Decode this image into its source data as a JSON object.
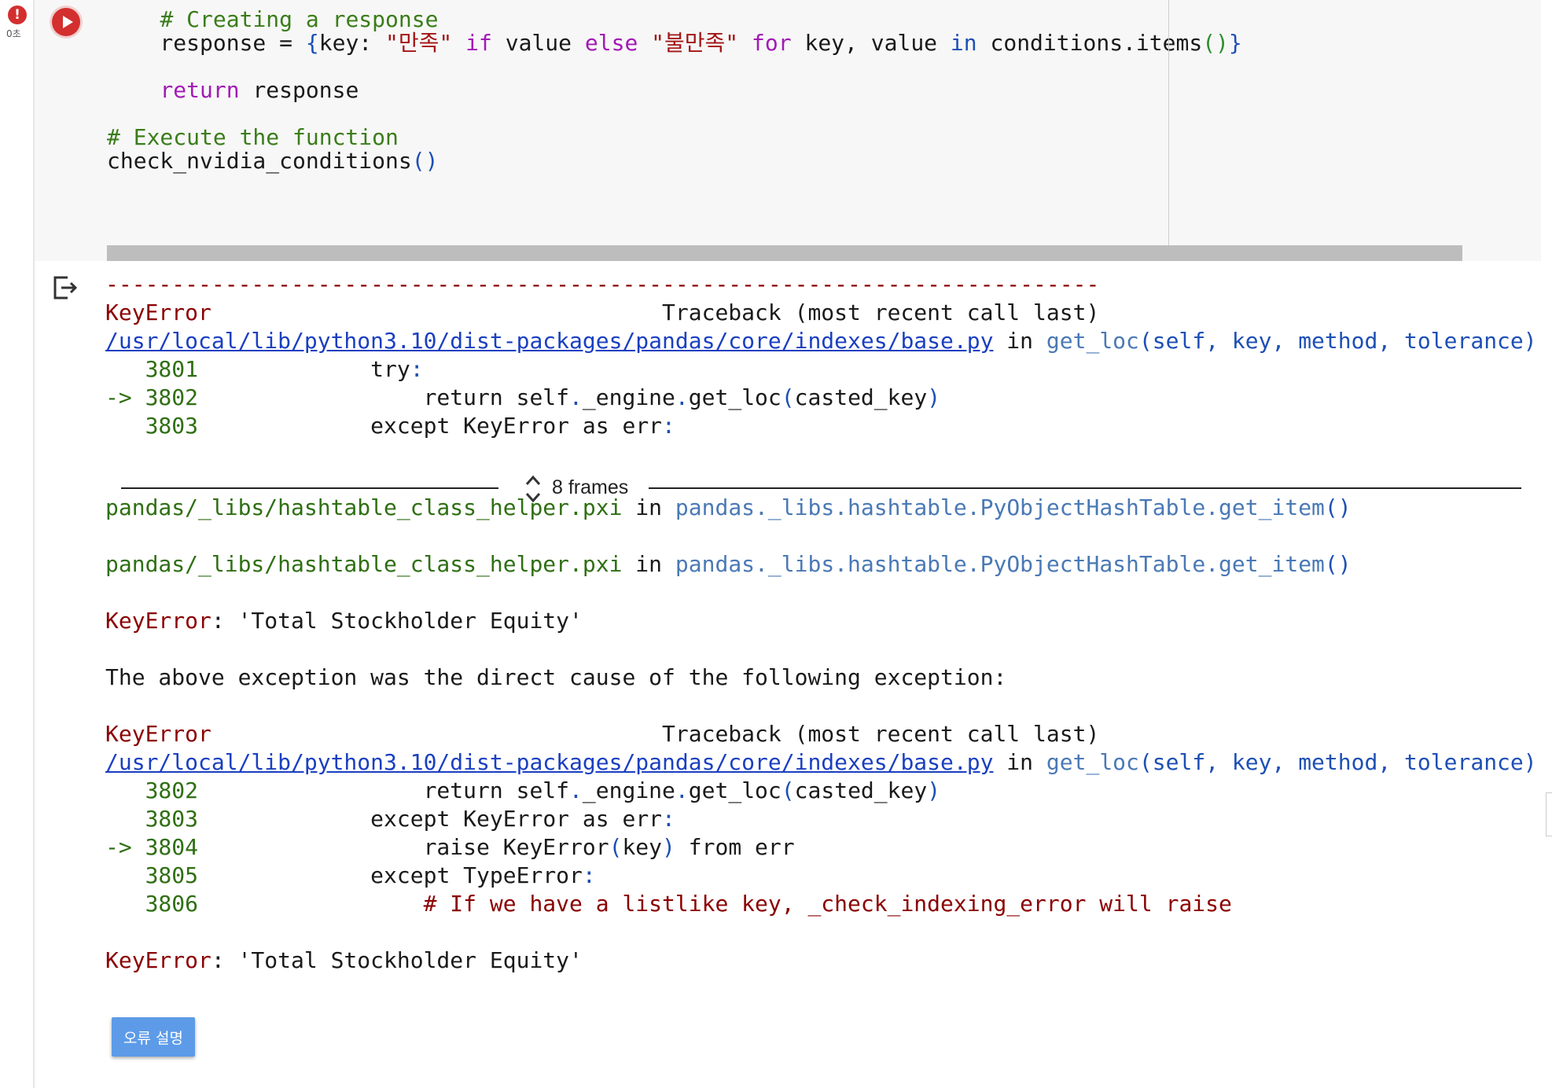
{
  "status": {
    "error_badge": "!",
    "exec_time": "0초"
  },
  "code_cell": {
    "lines": [
      [
        [
          "    ",
          ""
        ],
        [
          "# Creating a response",
          "c-comment"
        ]
      ],
      [
        [
          "    response = ",
          ""
        ],
        [
          "{",
          "c-paren-b"
        ],
        [
          "key: ",
          ""
        ],
        [
          "\"만족\"",
          "c-str"
        ],
        [
          " ",
          ""
        ],
        [
          "if",
          "c-kw"
        ],
        [
          " value ",
          ""
        ],
        [
          "else",
          "c-kw"
        ],
        [
          " ",
          ""
        ],
        [
          "\"불만족\"",
          "c-str"
        ],
        [
          " ",
          ""
        ],
        [
          "for",
          "c-kw"
        ],
        [
          " key, value ",
          ""
        ],
        [
          "in",
          "c-blue"
        ],
        [
          " conditions.items",
          ""
        ],
        [
          "()",
          "c-paren-g"
        ],
        [
          "}",
          "c-paren-b"
        ]
      ],
      [
        [
          "",
          ""
        ]
      ],
      [
        [
          "    ",
          ""
        ],
        [
          "return",
          "c-kw"
        ],
        [
          " response",
          ""
        ]
      ],
      [
        [
          "",
          ""
        ]
      ],
      [
        [
          "# Execute the function",
          "c-comment"
        ]
      ],
      [
        [
          "check_nvidia_conditions",
          ""
        ],
        [
          "()",
          "c-paren-b"
        ]
      ]
    ]
  },
  "output": {
    "lines": [
      [
        [
          "---------------------------------------------------------------------------",
          "c-red"
        ]
      ],
      [
        [
          "KeyError",
          "c-red"
        ],
        [
          "                                  Traceback (most recent call last)",
          ""
        ]
      ],
      [
        [
          "/usr/local/lib/python3.10/dist-packages/pandas/core/indexes/base.py",
          "c-link"
        ],
        [
          " in ",
          ""
        ],
        [
          "get_loc",
          "c-lblue"
        ],
        [
          "(",
          "c-paren-b"
        ],
        [
          "self, key, method, tolerance",
          "c-blue"
        ],
        [
          ")",
          "c-paren-b"
        ]
      ],
      [
        [
          "   3801             ",
          "c-green"
        ],
        [
          "try",
          ""
        ],
        [
          ":",
          "c-blue"
        ]
      ],
      [
        [
          "-> 3802                 ",
          "c-green"
        ],
        [
          "return",
          ""
        ],
        [
          " self",
          ""
        ],
        [
          ".",
          "c-blue"
        ],
        [
          "_engine",
          ""
        ],
        [
          ".",
          "c-blue"
        ],
        [
          "get_loc",
          ""
        ],
        [
          "(",
          "c-paren-b"
        ],
        [
          "casted_key",
          ""
        ],
        [
          ")",
          "c-paren-b"
        ]
      ],
      [
        [
          "   3803             ",
          "c-green"
        ],
        [
          "except",
          ""
        ],
        [
          " KeyError ",
          ""
        ],
        [
          "as",
          ""
        ],
        [
          " err",
          ""
        ],
        [
          ":",
          "c-blue"
        ]
      ]
    ],
    "lines_after_frames": [
      [
        [
          "pandas/_libs/hashtable_class_helper.pxi",
          "c-green"
        ],
        [
          " in ",
          ""
        ],
        [
          "pandas._libs.hashtable.PyObjectHashTable.get_item",
          "c-lblue"
        ],
        [
          "()",
          "c-paren-b"
        ]
      ],
      [
        [
          "",
          ""
        ]
      ],
      [
        [
          "pandas/_libs/hashtable_class_helper.pxi",
          "c-green"
        ],
        [
          " in ",
          ""
        ],
        [
          "pandas._libs.hashtable.PyObjectHashTable.get_item",
          "c-lblue"
        ],
        [
          "()",
          "c-paren-b"
        ]
      ],
      [
        [
          "",
          ""
        ]
      ],
      [
        [
          "KeyError",
          "c-red"
        ],
        [
          ": 'Total Stockholder Equity'",
          ""
        ]
      ],
      [
        [
          "",
          ""
        ]
      ],
      [
        [
          "The above exception was the direct cause of the following exception:",
          ""
        ]
      ],
      [
        [
          "",
          ""
        ]
      ],
      [
        [
          "KeyError",
          "c-red"
        ],
        [
          "                                  Traceback (most recent call last)",
          ""
        ]
      ],
      [
        [
          "/usr/local/lib/python3.10/dist-packages/pandas/core/indexes/base.py",
          "c-link"
        ],
        [
          " in ",
          ""
        ],
        [
          "get_loc",
          "c-lblue"
        ],
        [
          "(",
          "c-paren-b"
        ],
        [
          "self, key, method, tolerance",
          "c-blue"
        ],
        [
          ")",
          "c-paren-b"
        ]
      ],
      [
        [
          "   3802                 ",
          "c-green"
        ],
        [
          "return",
          ""
        ],
        [
          " self",
          ""
        ],
        [
          ".",
          "c-blue"
        ],
        [
          "_engine",
          ""
        ],
        [
          ".",
          "c-blue"
        ],
        [
          "get_loc",
          ""
        ],
        [
          "(",
          "c-paren-b"
        ],
        [
          "casted_key",
          ""
        ],
        [
          ")",
          "c-paren-b"
        ]
      ],
      [
        [
          "   3803             ",
          "c-green"
        ],
        [
          "except",
          ""
        ],
        [
          " KeyError ",
          ""
        ],
        [
          "as",
          ""
        ],
        [
          " err",
          ""
        ],
        [
          ":",
          "c-blue"
        ]
      ],
      [
        [
          "-> 3804                 ",
          "c-green"
        ],
        [
          "raise",
          ""
        ],
        [
          " KeyError",
          ""
        ],
        [
          "(",
          "c-paren-b"
        ],
        [
          "key",
          ""
        ],
        [
          ")",
          "c-paren-b"
        ],
        [
          " from",
          ""
        ],
        [
          " err",
          ""
        ]
      ],
      [
        [
          "   3805             ",
          "c-green"
        ],
        [
          "except",
          ""
        ],
        [
          " TypeError",
          ""
        ],
        [
          ":",
          "c-blue"
        ]
      ],
      [
        [
          "   3806                 ",
          "c-green"
        ],
        [
          "# If we have a listlike key, _check_indexing_error will raise",
          "c-red"
        ]
      ],
      [
        [
          "",
          ""
        ]
      ],
      [
        [
          "KeyError",
          "c-red"
        ],
        [
          ": 'Total Stockholder Equity'",
          ""
        ]
      ]
    ],
    "collapsed_frames_label": "8 frames"
  },
  "explain_button": {
    "label": "오류 설명"
  }
}
